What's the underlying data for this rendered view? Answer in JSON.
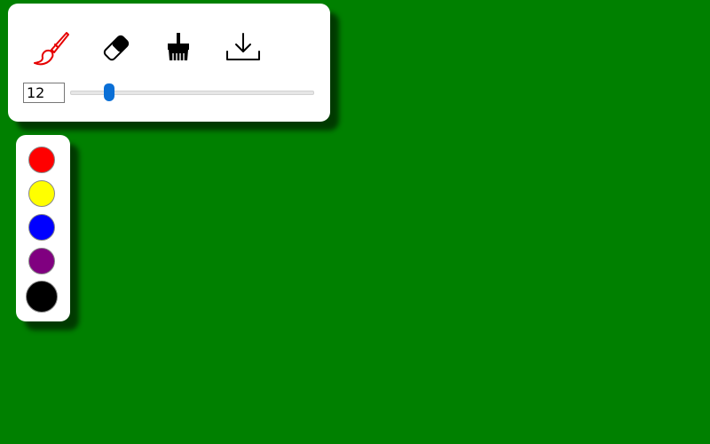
{
  "canvas": {
    "background_color": "#008000"
  },
  "toolbar": {
    "tools": [
      {
        "name": "brush-icon",
        "color": "#e60000",
        "active": true
      },
      {
        "name": "eraser-icon",
        "color": "#000000",
        "active": false
      },
      {
        "name": "clear-brush-icon",
        "color": "#000000",
        "active": false
      },
      {
        "name": "download-icon",
        "color": "#000000",
        "active": false
      }
    ],
    "brush_size": "12",
    "slider": {
      "min": 1,
      "max": 100,
      "value": 12,
      "accent": "#0a6fd6"
    }
  },
  "palette": {
    "colors": [
      "#ff0000",
      "#ffff00",
      "#0000ff",
      "#800080",
      "#000000"
    ],
    "selected": "#000000"
  }
}
